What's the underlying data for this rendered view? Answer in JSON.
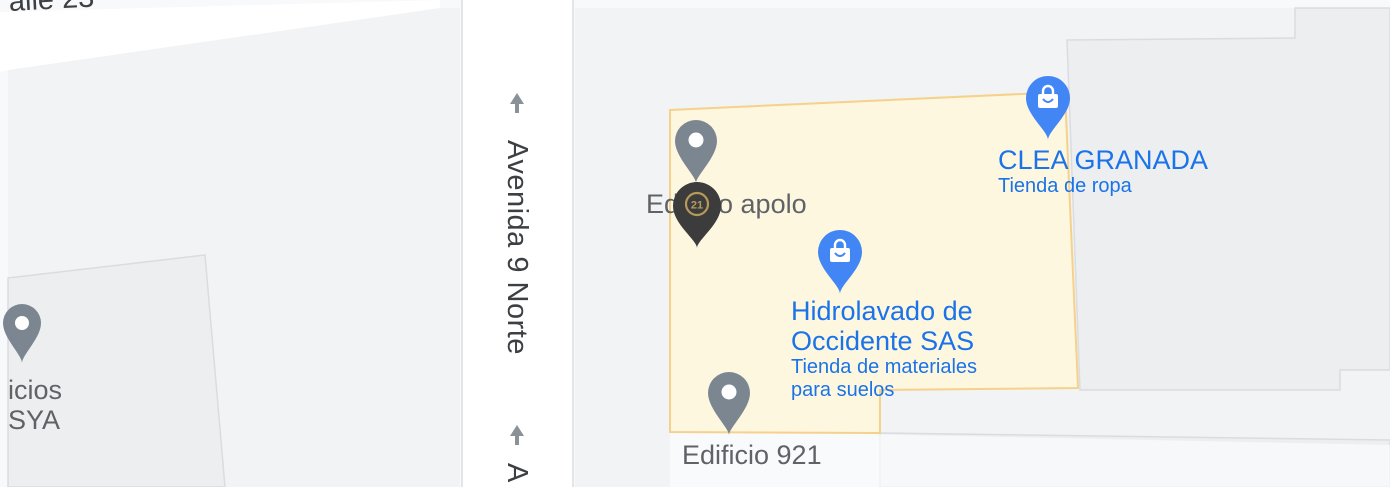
{
  "map": {
    "colors": {
      "background": "#f8f9fa",
      "road": "#ffffff",
      "block": "#f1f3f4",
      "block_edge": "#dadce0",
      "parcel_fill": "#fef7e0",
      "parcel_edge": "#f6d18b",
      "gray_pin": "#7b8690",
      "blue_pin": "#4285f4",
      "c21_pin": "#3c3c3c",
      "c21_badge": "#b69a5a"
    },
    "roads": [
      {
        "name": "Avenida 9 Norte",
        "direction_arrow": "↑"
      },
      {
        "name": "A"
      },
      {
        "name": "alle 23"
      }
    ],
    "places": [
      {
        "name": "Edificio apolo",
        "icon": "map-pin-icon"
      },
      {
        "name": "Edificio 921",
        "icon": "map-pin-icon"
      },
      {
        "name": "CLEA GRANADA",
        "category": "Tienda de ropa",
        "icon": "shopping-bag-icon"
      },
      {
        "name_lines": [
          "Hidrolavado de",
          "Occidente SAS"
        ],
        "category_lines": [
          "Tienda de materiales",
          "para suelos"
        ],
        "icon": "shopping-bag-icon"
      },
      {
        "name_lines": [
          "icios",
          "SYA"
        ],
        "icon": "map-pin-icon"
      }
    ],
    "marker": {
      "badge_text": "21",
      "icon": "century21-marker-icon"
    }
  }
}
